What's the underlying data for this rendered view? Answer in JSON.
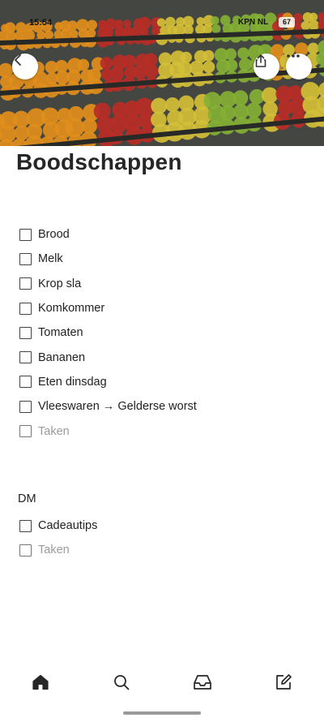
{
  "status_bar": {
    "time": "15:54",
    "carrier": "KPN NL",
    "battery": "67"
  },
  "cover": {
    "image_icon": "produce-shelves-photo",
    "colors": [
      "#f39a1e",
      "#c8312a",
      "#e6cf3d",
      "#8fbf3a",
      "#3a3d3a"
    ]
  },
  "toolbar": {
    "back_icon": "chevron-left-icon",
    "share_icon": "share-icon",
    "more_icon": "more-horizontal-icon"
  },
  "note": {
    "title": "Boodschappen",
    "list_1": [
      {
        "label": "Brood",
        "checked": false
      },
      {
        "label": "Melk",
        "checked": false
      },
      {
        "label": "Krop sla",
        "checked": false
      },
      {
        "label": "Komkommer",
        "checked": false
      },
      {
        "label": "Tomaten",
        "checked": false
      },
      {
        "label": "Bananen",
        "checked": false
      },
      {
        "label": "Eten dinsdag",
        "checked": false
      },
      {
        "label": "Vleeswaren → Gelderse worst",
        "checked": false
      }
    ],
    "list_1_placeholder": "Taken",
    "section_2_heading": "DM",
    "list_2": [
      {
        "label": "Cadeautips",
        "checked": false
      }
    ],
    "list_2_placeholder": "Taken"
  },
  "bottom_nav": {
    "items": [
      {
        "icon": "home-icon",
        "active": true
      },
      {
        "icon": "search-icon",
        "active": false
      },
      {
        "icon": "inbox-icon",
        "active": false
      },
      {
        "icon": "compose-icon",
        "active": false
      }
    ]
  }
}
